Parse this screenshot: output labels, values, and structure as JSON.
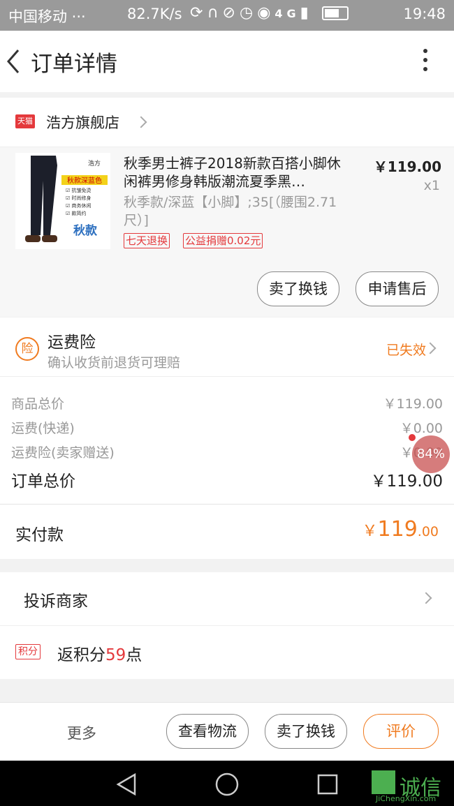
{
  "status_bar": {
    "carrier": "中国移动 ···",
    "speed": "82.7K/s",
    "icons": [
      "sync-icon",
      "headset-icon",
      "mute-icon",
      "alarm-icon",
      "eye-icon",
      "signal-4g-icon",
      "signal-icon",
      "battery-icon"
    ],
    "network": "4G",
    "time": "19:48"
  },
  "header": {
    "title": "订单详情"
  },
  "shop": {
    "badge": "天猫",
    "name": "浩方旗舰店"
  },
  "product": {
    "title": "秋季男士裤子2018新款百搭小脚休闲裤男修身韩版潮流夏季黑…",
    "sku": "秋季款/深蓝【小脚】;35[（腰围2.71尺）]",
    "tags": [
      "七天退换",
      "公益捐赠0.02元"
    ],
    "price": "￥119.00",
    "qty": "x1",
    "thumb_labels": {
      "brand": "浩方",
      "banner": "秋款深蓝色",
      "big": "秋款",
      "features": [
        "☑ 抗皱免烫",
        "☑ 时尚修身",
        "☑ 商务休闲",
        "☑ 款简约"
      ]
    },
    "buttons": {
      "resell": "卖了换钱",
      "after_sale": "申请售后"
    }
  },
  "insurance": {
    "icon_char": "险",
    "title": "运费险",
    "subtitle": "确认收货前退货可理赔",
    "status": "已失效"
  },
  "totals": {
    "rows": [
      {
        "label": "商品总价",
        "value": "￥119.00"
      },
      {
        "label": "运费(快递)",
        "value": "￥0.00"
      },
      {
        "label": "运费险(卖家赠送)",
        "value": "￥0.00"
      }
    ],
    "order_total_label": "订单总价",
    "order_total_value": "￥119.00",
    "floating_badge": "84%"
  },
  "paid": {
    "label": "实付款",
    "currency": "￥",
    "int": "119",
    "dec": ".00"
  },
  "complain": {
    "label": "投诉商家"
  },
  "points": {
    "badge": "积分",
    "prefix": "返积分",
    "value": "59",
    "suffix": "点"
  },
  "bottom_bar": {
    "more": "更多",
    "logistics": "查看物流",
    "resell": "卖了换钱",
    "review": "评价"
  },
  "watermark": "JiChengXin.com",
  "colors": {
    "accent": "#f07b20",
    "tmall_red": "#e4393c"
  }
}
